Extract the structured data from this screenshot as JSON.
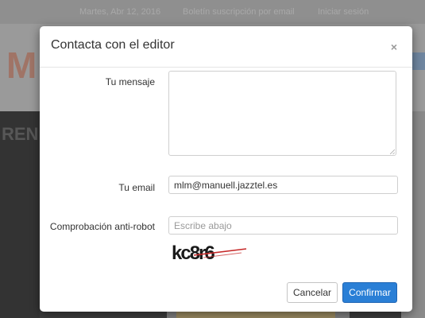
{
  "modal": {
    "title": "Contacta con el editor",
    "close_symbol": "×",
    "message_label": "Tu mensaje",
    "message_value": "",
    "email_label": "Tu email",
    "email_value": "mlm@manuell.jazztel.es",
    "robot_label": "Comprobación anti-robot",
    "robot_placeholder": "Escribe abajo",
    "captcha_text": "kc8r6",
    "cancel_label": "Cancelar",
    "confirm_label": "Confirmar"
  },
  "background": {
    "topbar_date": "Martes, Abr 12, 2016",
    "topbar_link1": "Boletín suscripción por email",
    "topbar_link2": "Iniciar sesión",
    "section_fragment": "REND"
  },
  "colors": {
    "confirm_button": "#2a7fd6",
    "overlay": "#8e8e8e"
  }
}
